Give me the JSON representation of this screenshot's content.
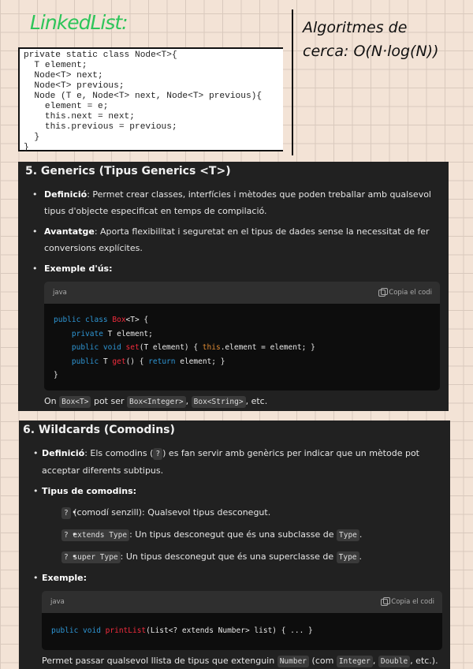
{
  "notes": {
    "title_linkedlist": "LinkedList:",
    "algo_line1": "Algoritmes de",
    "algo_line2": "cerca: O(N·log(N))"
  },
  "code_image": {
    "lines": [
      "private static class Node<T>{",
      "  T element;",
      "  Node<T> next;",
      "  Node<T> previous;",
      "  Node (T e, Node<T> next, Node<T> previous){",
      "    element = e;",
      "    this.next = next;",
      "    this.previous = previous;",
      "  }",
      "}"
    ]
  },
  "section5": {
    "title": "5. Generics (Tipus Generics <T>)",
    "def_label": "Definició",
    "def_text": ": Permet crear classes, interfícies i mètodes que poden treballar amb qualsevol tipus d'objecte especificat en temps de compilació.",
    "adv_label": "Avantatge",
    "adv_text": ": Aporta flexibilitat i seguretat en el tipus de dades sense la necessitat de fer conversions explícites.",
    "ex_label": "Exemple d'ús:",
    "code_lang": "java",
    "copy_label": "Copia el codi",
    "after": {
      "t1": "On ",
      "c1": "Box<T>",
      "t2": " pot ser ",
      "c2": "Box<Integer>",
      "t3": ", ",
      "c3": "Box<String>",
      "t4": ", etc."
    }
  },
  "section6": {
    "title": "6. Wildcards (Comodins)",
    "def_label": "Definició",
    "def_t1": ": Els comodins (",
    "def_c": "?",
    "def_t2": ") es fan servir amb genèrics per indicar que un mètode pot acceptar diferents subtipus.",
    "types_label": "Tipus de comodins:",
    "sub": [
      {
        "code": "?",
        "text": " (comodí senzill): Qualsevol tipus desconegut.",
        "code2": "",
        "end": ""
      },
      {
        "code": "? extends Type",
        "text": ": Un tipus desconegut que és una subclasse de ",
        "code2": "Type",
        "end": "."
      },
      {
        "code": "? super Type",
        "text": ": Un tipus desconegut que és una superclasse de ",
        "code2": "Type",
        "end": "."
      }
    ],
    "ex_label": "Exemple:",
    "code_lang": "java",
    "copy_label": "Copia el codi",
    "after": {
      "t1": "Permet passar qualsevol llista de tipus que extenguin ",
      "c1": "Number",
      "t2": " (com ",
      "c2": "Integer",
      "t3": ", ",
      "c3": "Double",
      "t4": ", etc.)."
    }
  }
}
